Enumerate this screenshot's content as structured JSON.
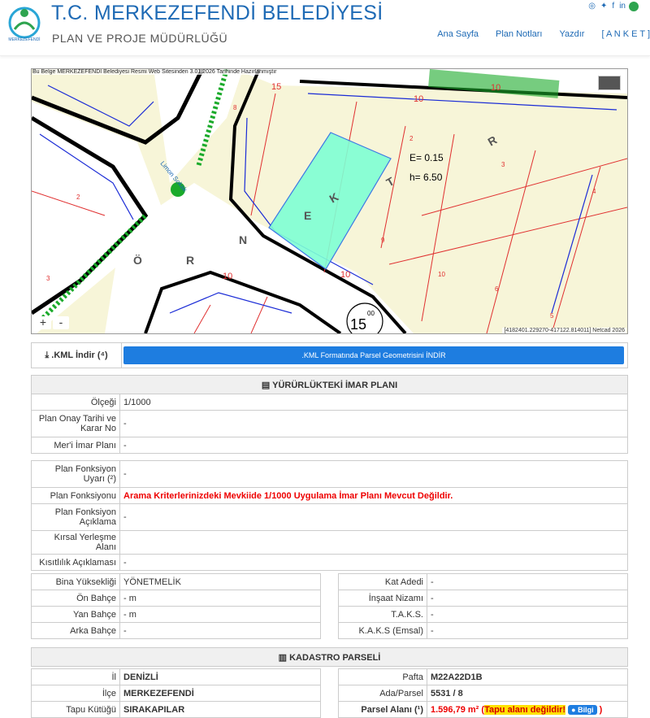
{
  "header": {
    "title": "T.C. MERKEZEFENDİ BELEDİYESİ",
    "subtitle": "PLAN VE PROJE MÜDÜRLÜĞÜ",
    "nav": [
      "Ana Sayfa",
      "Plan Notları",
      "Yazdır",
      "[ A N K E T ]"
    ]
  },
  "map": {
    "note": "Bu Belge MERKEZEFENDİ Belediyesi Resmi Web Sitesinden 3.01.2026 Tarihinde Hazırlanmıştır",
    "coords": "[4182401.229270-417122.814011] Netcad 2026",
    "zoom_in": "+",
    "zoom_out": "-",
    "labels": {
      "e": "E= 0.15",
      "h": "h= 6.50",
      "road_num": "15",
      "road_sup": "00",
      "street": "Limon Sokak",
      "num_10": "10"
    }
  },
  "kml": {
    "label": ".KML İndir (⁴)",
    "button": ".KML Formatında Parsel Geometrisini İNDİR"
  },
  "imar": {
    "heading": "YÜRÜRLÜKTEKİ İMAR PLANI",
    "rows": [
      {
        "label": "Ölçeği",
        "value": "1/1000"
      },
      {
        "label": "Plan Onay Tarihi ve Karar No",
        "value": "-"
      },
      {
        "label": "Mer'i İmar Planı",
        "value": "-"
      }
    ]
  },
  "fonksiyon": {
    "rows": [
      {
        "label": "Plan Fonksiyon Uyarı (²)",
        "value": "-"
      },
      {
        "label": "Plan Fonksiyonu",
        "value": "Arama Kriterlerinizdeki Mevkiide 1/1000 Uygulama İmar Planı Mevcut Değildir."
      },
      {
        "label": "Plan Fonksiyon Açıklama",
        "value": "-"
      },
      {
        "label": "Kırsal Yerleşme Alanı",
        "value": ""
      },
      {
        "label": "Kısıtlılık Açıklaması",
        "value": "-"
      }
    ]
  },
  "bina_left": [
    {
      "label": "Bina Yüksekliği",
      "value": "YÖNETMELİK"
    },
    {
      "label": "Ön Bahçe",
      "value": "- m"
    },
    {
      "label": "Yan Bahçe",
      "value": "- m"
    },
    {
      "label": "Arka Bahçe",
      "value": "-"
    }
  ],
  "bina_right": [
    {
      "label": "Kat Adedi",
      "value": "-"
    },
    {
      "label": "İnşaat Nizamı",
      "value": "-"
    },
    {
      "label": "T.A.K.S.",
      "value": "-"
    },
    {
      "label": "K.A.K.S (Emsal)",
      "value": "-"
    }
  ],
  "kadastro": {
    "heading": "KADASTRO PARSELİ",
    "left": [
      {
        "label": "İl",
        "value": "DENİZLİ"
      },
      {
        "label": "İlçe",
        "value": "MERKEZEFENDİ"
      },
      {
        "label": "Tapu Kütüğü",
        "value": "SIRAKAPILAR"
      }
    ],
    "right": [
      {
        "label": "Pafta",
        "value": "M22A22D1B"
      },
      {
        "label": "Ada/Parsel",
        "value": "5531 / 8"
      },
      {
        "label": "Parsel Alanı (¹)",
        "value": "1.596,79 m²",
        "warn": "Tapu alanı değildir!",
        "info": "Bilgi"
      }
    ]
  },
  "colors": {
    "brand": "#1e6ab5",
    "button": "#1e7de0",
    "warning": "#e00000",
    "parcel_fill": "#7fffd4"
  }
}
